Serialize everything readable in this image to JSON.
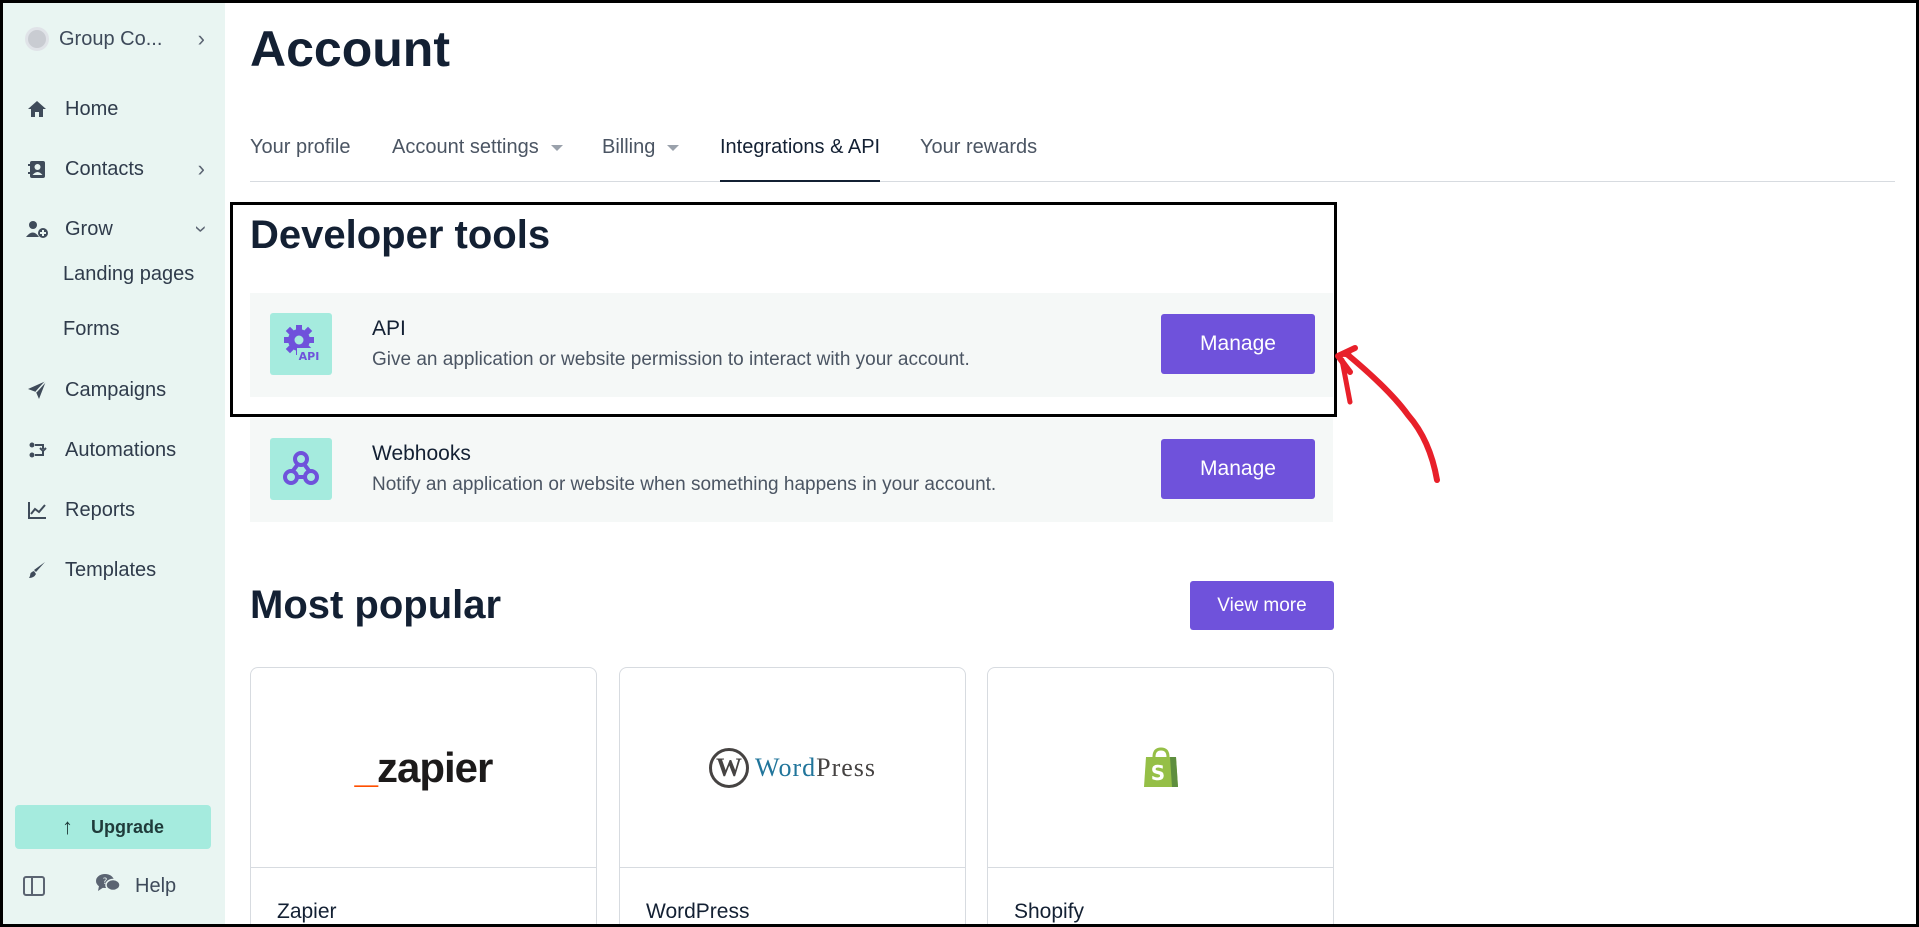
{
  "sidebar": {
    "account_name": "Group Co...",
    "nav": {
      "home": "Home",
      "contacts": "Contacts",
      "grow": "Grow",
      "landing_pages": "Landing pages",
      "forms": "Forms",
      "campaigns": "Campaigns",
      "automations": "Automations",
      "reports": "Reports",
      "templates": "Templates"
    },
    "upgrade_label": "Upgrade",
    "help_label": "Help"
  },
  "page": {
    "title": "Account"
  },
  "tabs": {
    "your_profile": "Your profile",
    "account_settings": "Account settings",
    "billing": "Billing",
    "integrations_api": "Integrations & API",
    "your_rewards": "Your rewards",
    "active": "integrations_api"
  },
  "developer_tools": {
    "title": "Developer tools",
    "api": {
      "name": "API",
      "description": "Give an application or website permission to interact with your account.",
      "button": "Manage",
      "icon_text": "API"
    },
    "webhooks": {
      "name": "Webhooks",
      "description": "Notify an application or website when something happens in your account.",
      "button": "Manage"
    }
  },
  "most_popular": {
    "title": "Most popular",
    "view_more": "View more",
    "cards": {
      "zapier": {
        "name": "Zapier",
        "logo_text": "zapier"
      },
      "wordpress": {
        "name": "WordPress",
        "logo_text_a": "Word",
        "logo_text_b": "Press"
      },
      "shopify": {
        "name": "Shopify"
      }
    }
  },
  "colors": {
    "sidebar_bg": "#e9f5f2",
    "accent": "#6f52db",
    "teal": "#a5ebde",
    "annotation_red": "#e8202a"
  },
  "icons": {
    "home": "home-icon",
    "contacts": "contacts-icon",
    "grow": "grow-icon",
    "campaigns": "paper-plane-icon",
    "automations": "automations-icon",
    "reports": "chart-icon",
    "templates": "brush-icon"
  }
}
